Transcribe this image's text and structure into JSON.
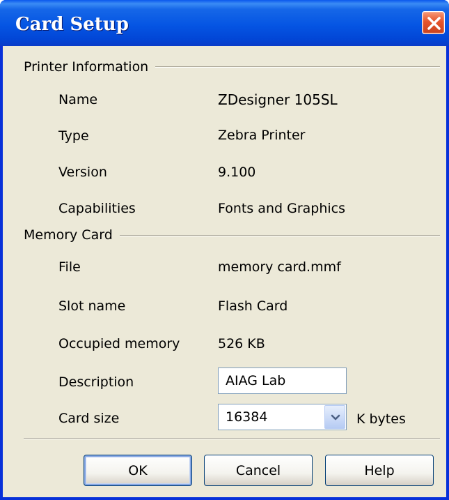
{
  "window": {
    "title": "Card Setup",
    "close_icon": "close-icon",
    "accent_color": "#0054e3"
  },
  "printer_info": {
    "group_label": "Printer Information",
    "rows": [
      {
        "label": "Name",
        "value": "ZDesigner 105SL"
      },
      {
        "label": "Type",
        "value": "Zebra Printer"
      },
      {
        "label": "Version",
        "value": "9.100"
      },
      {
        "label": "Capabilities",
        "value": "Fonts and Graphics"
      }
    ]
  },
  "memory_card": {
    "group_label": "Memory Card",
    "rows": [
      {
        "label": "File",
        "value": "memory card.mmf"
      },
      {
        "label": "Slot name",
        "value": "Flash Card"
      },
      {
        "label": "Occupied memory",
        "value": "526 KB"
      }
    ],
    "description": {
      "label": "Description",
      "value": "AIAG Lab"
    },
    "card_size": {
      "label": "Card size",
      "value": "16384",
      "unit": "K bytes",
      "dropdown_icon": "chevron-down-icon"
    }
  },
  "buttons": {
    "ok": "OK",
    "cancel": "Cancel",
    "help": "Help"
  }
}
